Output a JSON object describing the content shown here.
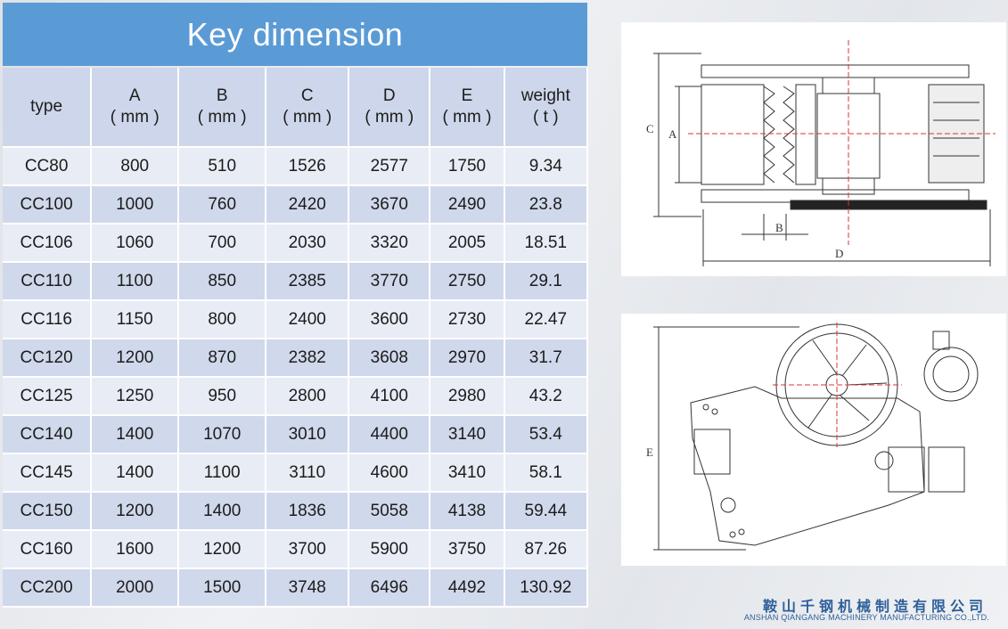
{
  "title": "Key dimension",
  "table": {
    "headers": [
      {
        "name": "type",
        "unit": ""
      },
      {
        "name": "A",
        "unit": "( mm )"
      },
      {
        "name": "B",
        "unit": "( mm )"
      },
      {
        "name": "C",
        "unit": "( mm )"
      },
      {
        "name": "D",
        "unit": "( mm )"
      },
      {
        "name": "E",
        "unit": "( mm )"
      },
      {
        "name": "weight",
        "unit": "( t )"
      }
    ],
    "rows": [
      [
        "CC80",
        "800",
        "510",
        "1526",
        "2577",
        "1750",
        "9.34"
      ],
      [
        "CC100",
        "1000",
        "760",
        "2420",
        "3670",
        "2490",
        "23.8"
      ],
      [
        "CC106",
        "1060",
        "700",
        "2030",
        "3320",
        "2005",
        "18.51"
      ],
      [
        "CC110",
        "1100",
        "850",
        "2385",
        "3770",
        "2750",
        "29.1"
      ],
      [
        "CC116",
        "1150",
        "800",
        "2400",
        "3600",
        "2730",
        "22.47"
      ],
      [
        "CC120",
        "1200",
        "870",
        "2382",
        "3608",
        "2970",
        "31.7"
      ],
      [
        "CC125",
        "1250",
        "950",
        "2800",
        "4100",
        "2980",
        "43.2"
      ],
      [
        "CC140",
        "1400",
        "1070",
        "3010",
        "4400",
        "3140",
        "53.4"
      ],
      [
        "CC145",
        "1400",
        "1100",
        "3110",
        "4600",
        "3410",
        "58.1"
      ],
      [
        "CC150",
        "1200",
        "1400",
        "1836",
        "5058",
        "4138",
        "59.44"
      ],
      [
        "CC160",
        "1600",
        "1200",
        "3700",
        "5900",
        "3750",
        "87.26"
      ],
      [
        "CC200",
        "2000",
        "1500",
        "3748",
        "6496",
        "4492",
        "130.92"
      ]
    ]
  },
  "drawing_top": {
    "labels": {
      "a": "A",
      "b": "B",
      "c": "C",
      "d": "D"
    }
  },
  "drawing_side": {
    "labels": {
      "e": "E"
    }
  },
  "company": {
    "name_cn": "鞍山千钢机械制造有限公司",
    "name_en": "ANSHAN QIANGANG MACHINERY MANUFACTURING CO.,LTD."
  }
}
